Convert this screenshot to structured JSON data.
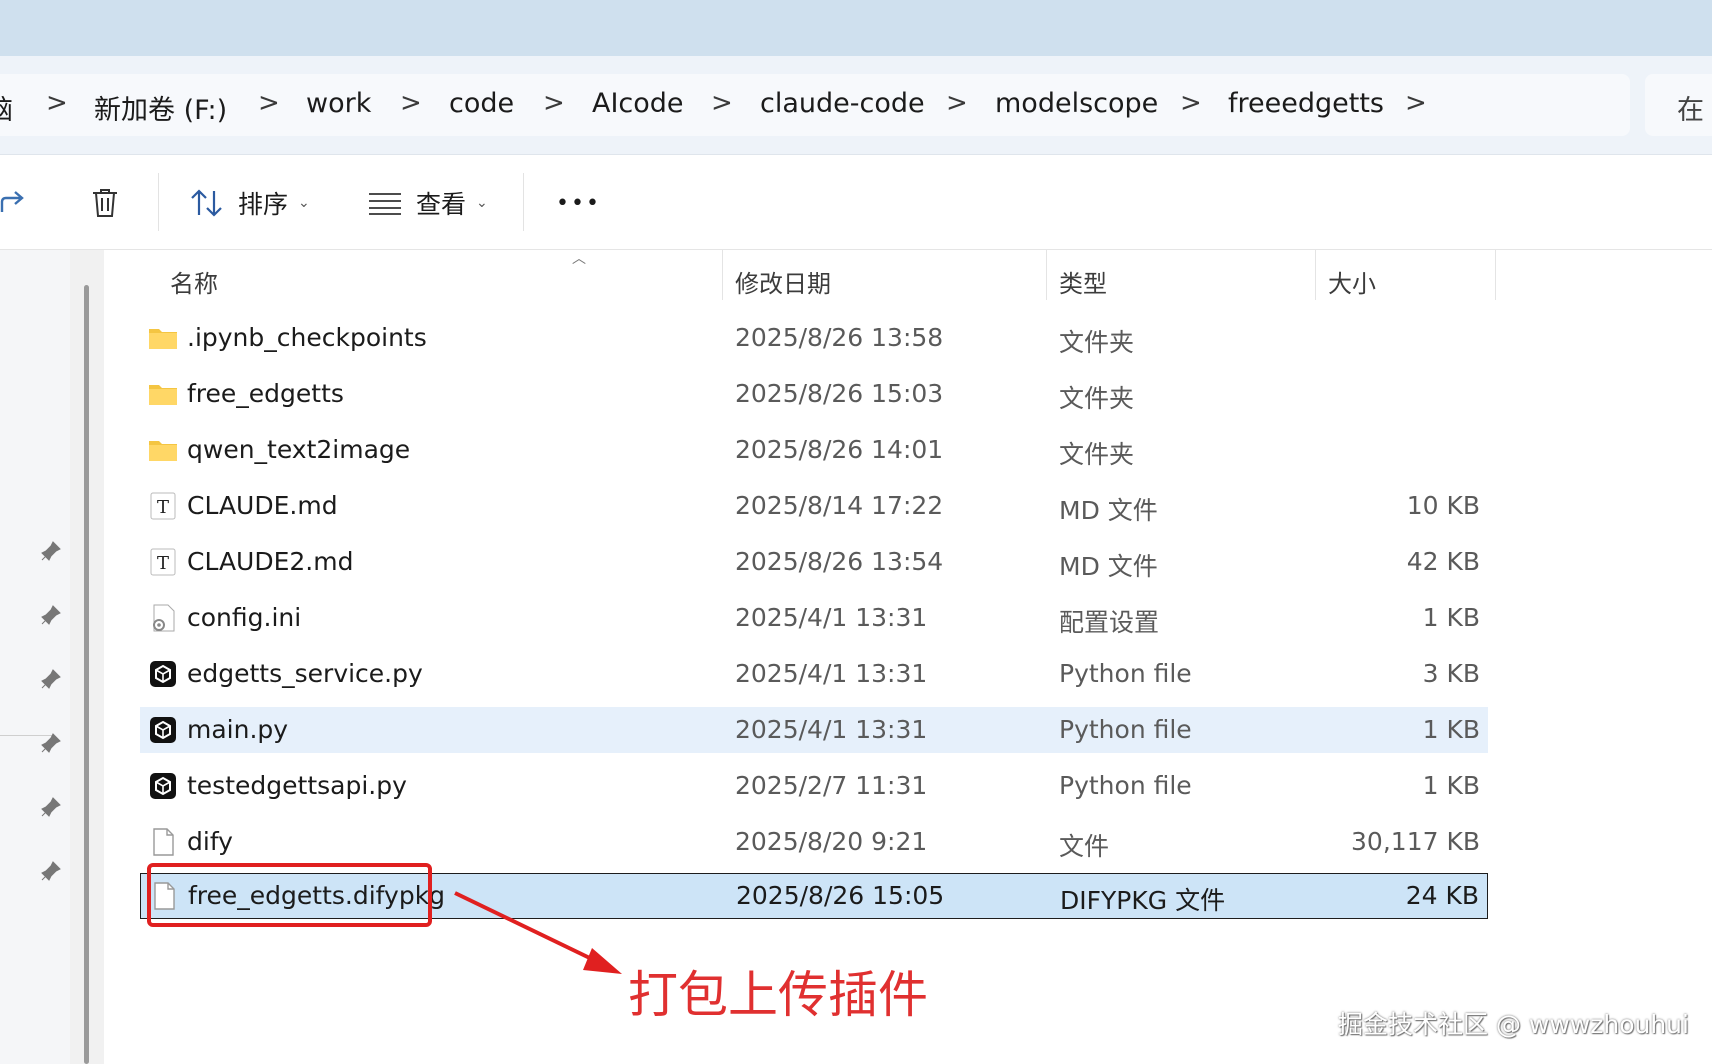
{
  "breadcrumb": {
    "items": [
      "脑",
      "新加卷 (F:)",
      "work",
      "code",
      "AIcode",
      "claude-code",
      "modelscope",
      "freeedgetts"
    ],
    "separator": ">"
  },
  "search": {
    "label": "在"
  },
  "toolbar": {
    "sort_label": "排序",
    "view_label": "查看",
    "more_label": "•••"
  },
  "columns": {
    "name": "名称",
    "date": "修改日期",
    "type": "类型",
    "size": "大小"
  },
  "files": [
    {
      "name": ".ipynb_checkpoints",
      "date": "2025/8/26 13:58",
      "type": "文件夹",
      "size": "",
      "icon": "folder-icon"
    },
    {
      "name": "free_edgetts",
      "date": "2025/8/26 15:03",
      "type": "文件夹",
      "size": "",
      "icon": "folder-icon"
    },
    {
      "name": "qwen_text2image",
      "date": "2025/8/26 14:01",
      "type": "文件夹",
      "size": "",
      "icon": "folder-icon"
    },
    {
      "name": "CLAUDE.md",
      "date": "2025/8/14 17:22",
      "type": "MD 文件",
      "size": "10 KB",
      "icon": "text-file-icon",
      "glyph": "T"
    },
    {
      "name": "CLAUDE2.md",
      "date": "2025/8/26 13:54",
      "type": "MD 文件",
      "size": "42 KB",
      "icon": "text-file-icon",
      "glyph": "T"
    },
    {
      "name": "config.ini",
      "date": "2025/4/1 13:31",
      "type": "配置设置",
      "size": "1 KB",
      "icon": "config-file-icon"
    },
    {
      "name": "edgetts_service.py",
      "date": "2025/4/1 13:31",
      "type": "Python file",
      "size": "3 KB",
      "icon": "python-file-icon"
    },
    {
      "name": "main.py",
      "date": "2025/4/1 13:31",
      "type": "Python file",
      "size": "1 KB",
      "icon": "python-file-icon"
    },
    {
      "name": "testedgettsapi.py",
      "date": "2025/2/7 11:31",
      "type": "Python file",
      "size": "1 KB",
      "icon": "python-file-icon"
    },
    {
      "name": "dify",
      "date": "2025/8/20 9:21",
      "type": "文件",
      "size": "30,117 KB",
      "icon": "blank-file-icon"
    },
    {
      "name": "free_edgetts.difypkg",
      "date": "2025/8/26 15:05",
      "type": "DIFYPKG 文件",
      "size": "24 KB",
      "icon": "blank-file-icon"
    }
  ],
  "annotation": {
    "text": "打包上传插件",
    "color": "#e02020"
  },
  "watermark": {
    "text": "掘金技术社区 @ wwwzhouhui"
  },
  "colors": {
    "selected_row": "#cde4f7",
    "hover_row": "#e6f0fb",
    "folder": "#f4c542",
    "titlebar": "#cfe0ee"
  }
}
